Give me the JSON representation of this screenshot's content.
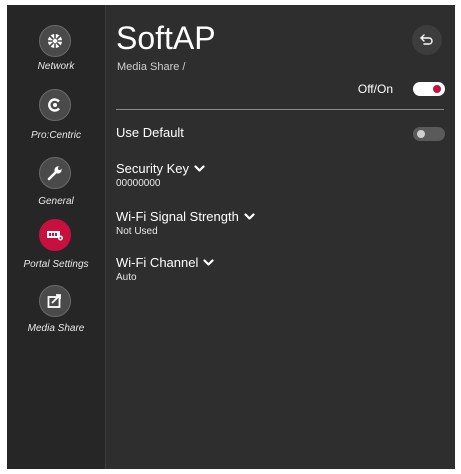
{
  "sidebar": {
    "items": [
      {
        "label": "Network",
        "icon": "network-icon",
        "active": false
      },
      {
        "label": "Pro:Centric",
        "icon": "procentric-icon",
        "active": false
      },
      {
        "label": "General",
        "icon": "wrench-icon",
        "active": false
      },
      {
        "label": "Portal Settings",
        "icon": "portal-settings-icon",
        "active": true
      },
      {
        "label": "Media Share",
        "icon": "media-share-icon",
        "active": false
      }
    ]
  },
  "header": {
    "title": "SoftAP",
    "breadcrumb": "Media Share /",
    "back_icon": "back-arrow-icon"
  },
  "main": {
    "power_toggle": {
      "label": "Off/On",
      "state": "on"
    },
    "use_default": {
      "label": "Use Default",
      "state": "off"
    },
    "settings": [
      {
        "label": "Security Key",
        "value": "00000000"
      },
      {
        "label": "Wi-Fi Signal Strength",
        "value": "Not Used"
      },
      {
        "label": "Wi-Fi Channel",
        "value": "Auto"
      }
    ]
  },
  "colors": {
    "accent": "#c8103f",
    "background": "#2e2e2e",
    "sidebar": "#262626"
  }
}
